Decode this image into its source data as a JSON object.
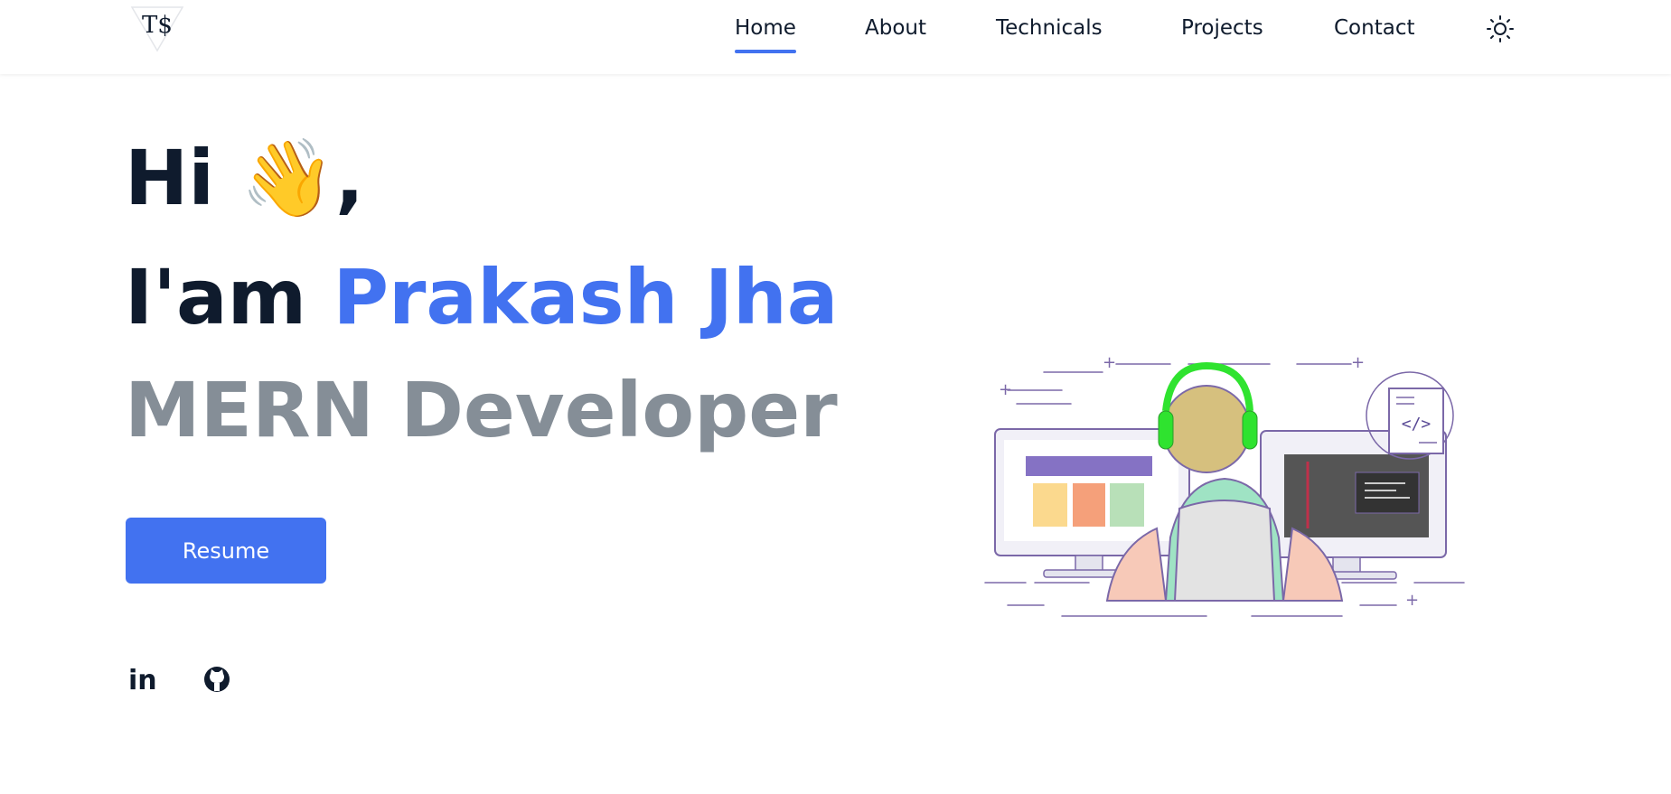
{
  "brand": {
    "logo_text": "T$"
  },
  "nav": {
    "items": [
      {
        "label": "Home",
        "active": true
      },
      {
        "label": "About",
        "active": false
      },
      {
        "label": "Technicals",
        "active": false
      },
      {
        "label": "Projects",
        "active": false
      },
      {
        "label": "Contact",
        "active": false
      }
    ],
    "theme_icon": "sun-icon"
  },
  "hero": {
    "greeting": "Hi",
    "wave_emoji": "👋",
    "comma": ",",
    "intro": "I'am",
    "name": "Prakash Jha",
    "role": "MERN Developer",
    "resume_label": "Resume"
  },
  "social": {
    "linkedin_label": "in",
    "links": [
      "linkedin-icon",
      "github-icon"
    ]
  },
  "illustration": {
    "code_tag": "</>",
    "subject": "developer-at-dual-monitors"
  },
  "colors": {
    "accent": "#4272f0",
    "text": "#0f1b2d",
    "muted": "#858e97",
    "illustration_line": "#7b68a8"
  }
}
